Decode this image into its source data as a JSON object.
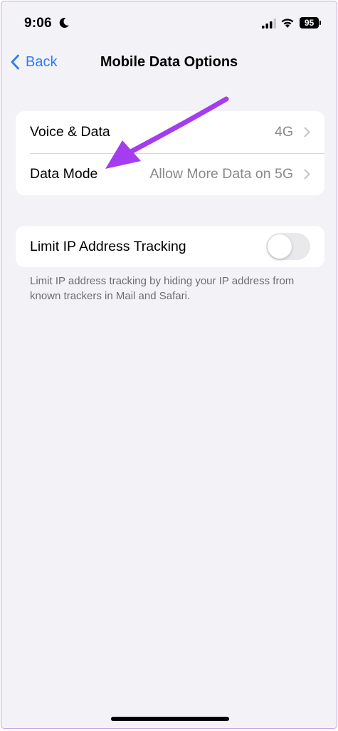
{
  "status_bar": {
    "time": "9:06",
    "battery": "95",
    "icons": [
      "moon-icon",
      "signal-icon",
      "wifi-icon",
      "battery-icon"
    ]
  },
  "nav": {
    "back_label": "Back",
    "title": "Mobile Data Options"
  },
  "group1": {
    "rows": [
      {
        "label": "Voice & Data",
        "value": "4G"
      },
      {
        "label": "Data Mode",
        "value": "Allow More Data on 5G"
      }
    ]
  },
  "group2": {
    "label": "Limit IP Address Tracking",
    "toggle_on": false,
    "footer": "Limit IP address tracking by hiding your IP address from known trackers in Mail and Safari."
  },
  "colors": {
    "accent": "#2f7cf6",
    "annotation_arrow": "#a43cf0",
    "background": "#f2f2f7"
  }
}
